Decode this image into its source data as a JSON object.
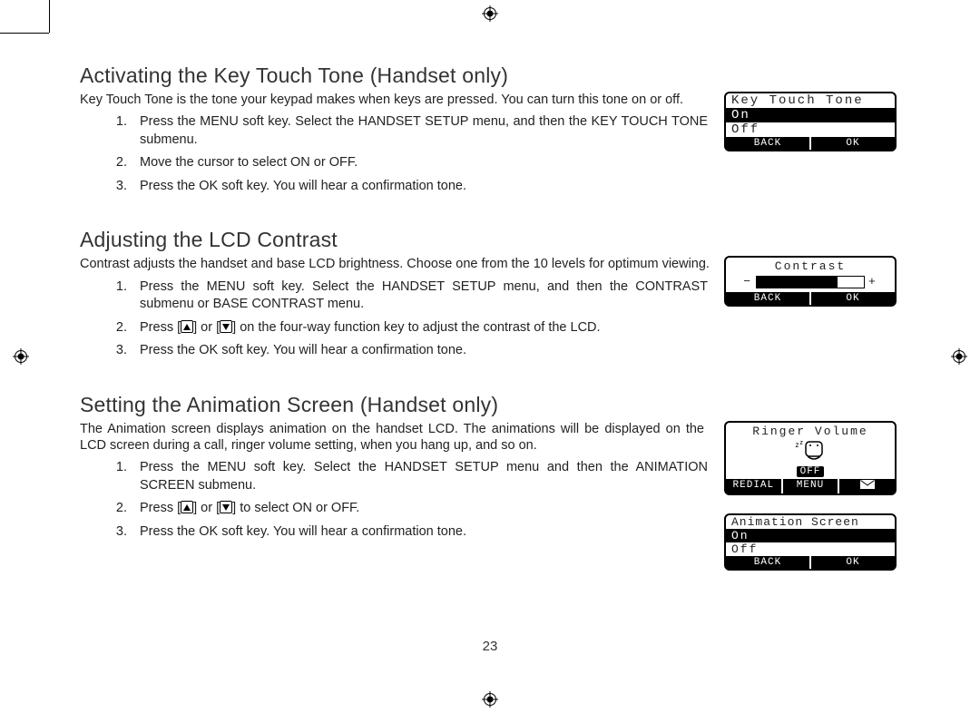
{
  "page_number": "23",
  "sec1": {
    "heading": "Activating the Key Touch Tone (Handset only)",
    "lead": "Key Touch Tone is the tone your keypad makes when keys are pressed. You can turn this tone on or off.",
    "step1": "Press the MENU soft key. Select the HANDSET SETUP menu, and then the KEY TOUCH TONE submenu.",
    "step2": "Move the cursor to select ON or OFF.",
    "step3": "Press the OK soft key. You will hear a confirmation tone.",
    "lcd": {
      "title": "Key Touch Tone",
      "on": "On",
      "off": "Off",
      "back": "BACK",
      "ok": "OK"
    }
  },
  "sec2": {
    "heading": "Adjusting the LCD Contrast",
    "lead": "Contrast adjusts the handset and base LCD brightness. Choose one from the 10 levels for optimum viewing.",
    "step1": "Press the MENU soft key. Select the HANDSET SETUP menu, and then the CONTRAST submenu or BASE CONTRAST menu.",
    "step2a": "Press [",
    "step2b": "] or [",
    "step2c": "] on the four-way function key to adjust the contrast of the LCD.",
    "step3": "Press the OK soft key. You will hear a confirmation tone.",
    "lcd": {
      "title": "Contrast",
      "minus": "−",
      "plus": "+",
      "back": "BACK",
      "ok": "OK"
    }
  },
  "sec3": {
    "heading": "Setting the Animation Screen (Handset only)",
    "lead": "The Animation screen displays animation on the handset LCD. The animations will be displayed on the LCD screen during a call, ringer volume setting, when you hang up, and so on.",
    "step1": "Press the MENU soft key. Select the HANDSET SETUP menu and then the ANIMATION SCREEN submenu.",
    "step2a": "Press [",
    "step2b": "] or [",
    "step2c": "] to select ON or OFF.",
    "step3": "Press the OK soft key. You will hear a confirmation tone.",
    "lcd1": {
      "title": "Ringer Volume",
      "off": "OFF",
      "redial": "REDIAL",
      "menu": "MENU"
    },
    "lcd2": {
      "title": "Animation Screen",
      "on": "On",
      "off": "Off",
      "back": "BACK",
      "ok": "OK"
    }
  }
}
